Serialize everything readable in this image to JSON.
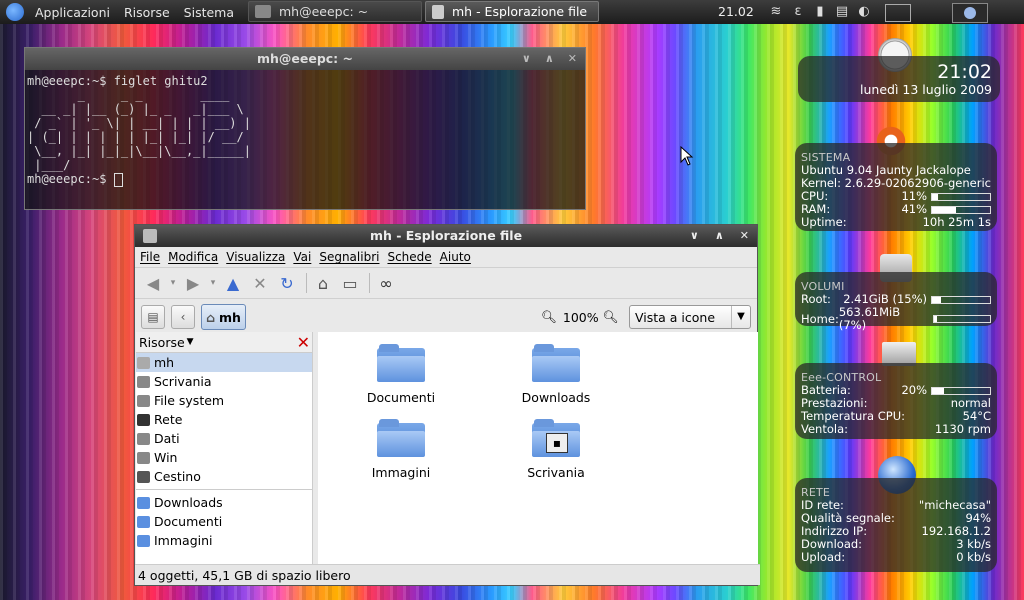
{
  "panel": {
    "menus": [
      "Applicazioni",
      "Risorse",
      "Sistema"
    ],
    "tasks": [
      {
        "label": "mh@eeepc: ~"
      },
      {
        "label": "mh - Esplorazione file"
      }
    ],
    "clock": "21.02"
  },
  "terminal": {
    "title": "mh@eeepc: ~",
    "lines": [
      "mh@eeepc:~$ figlet ghitu2",
      "       _     _ _        ____",
      "  __ _| |__ (_) |_ _   _|___ \\",
      " / _` | '_ \\| | __| | | | __) |",
      "| (_| | | | | | |_| |_| |/ __/",
      " \\__, |_| |_|_|\\__|\\__,_|_____|",
      " |___/",
      "mh@eeepc:~$ "
    ]
  },
  "filemanager": {
    "title": "mh - Esplorazione file",
    "menu": [
      "File",
      "Modifica",
      "Visualizza",
      "Vai",
      "Segnalibri",
      "Schede",
      "Aiuto"
    ],
    "breadcrumb": "mh",
    "zoom": "100%",
    "view": "Vista a icone",
    "sidepane_title": "Risorse",
    "places": [
      "mh",
      "Scrivania",
      "File system",
      "Rete",
      "Dati",
      "Win",
      "Cestino"
    ],
    "bookmarks": [
      "Downloads",
      "Documenti",
      "Immagini"
    ],
    "files": [
      "Documenti",
      "Downloads",
      "Immagini",
      "Scrivania"
    ],
    "status": "4 oggetti, 45,1 GB di spazio libero"
  },
  "conky": {
    "time": "21:02",
    "date": "lunedì 13 luglio 2009",
    "sistema": {
      "title": "SISTEMA",
      "os": "Ubuntu 9.04 Jaunty Jackalope",
      "kernel_label": "Kernel:",
      "kernel": "2.6.29-02062906-generic",
      "cpu_label": "CPU:",
      "cpu": "11%",
      "ram_label": "RAM:",
      "ram": "41%",
      "uptime_label": "Uptime:",
      "uptime": "10h 25m 1s"
    },
    "volumi": {
      "title": "VOLUMI",
      "root_label": "Root:",
      "root": "2.41GiB (15%)",
      "home_label": "Home:",
      "home": "563.61MiB (7%)"
    },
    "eee": {
      "title": "Eee-CONTROL",
      "batt_label": "Batteria:",
      "batt": "20%",
      "prest_label": "Prestazioni:",
      "prest": "normal",
      "temp_label": "Temperatura CPU:",
      "temp": "54°C",
      "fan_label": "Ventola:",
      "fan": "1130 rpm"
    },
    "rete": {
      "title": "RETE",
      "id_label": "ID rete:",
      "id": "\"michecasa\"",
      "q_label": "Qualità segnale:",
      "q": "94%",
      "ip_label": "Indirizzo IP:",
      "ip": "192.168.1.2",
      "dl_label": "Download:",
      "dl": "3 kb/s",
      "ul_label": "Upload:",
      "ul": "0 kb/s"
    },
    "levels": {
      "cpu": 0.11,
      "ram": 0.41,
      "root": 0.15,
      "home": 0.07,
      "batt": 0.2
    }
  }
}
